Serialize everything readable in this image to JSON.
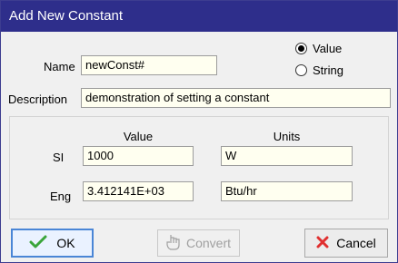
{
  "window": {
    "title": "Add New Constant"
  },
  "form": {
    "name_label": "Name",
    "name_value": "newConst#",
    "description_label": "Description",
    "description_value": "demonstration of setting a constant",
    "type_options": {
      "value_label": "Value",
      "string_label": "String",
      "selected": "Value"
    }
  },
  "table": {
    "value_header": "Value",
    "units_header": "Units",
    "si_label": "SI",
    "si_value": "1000",
    "si_units": "W",
    "eng_label": "Eng",
    "eng_value": "3.412141E+03",
    "eng_units": "Btu/hr"
  },
  "buttons": {
    "ok_label": "OK",
    "convert_label": "Convert",
    "cancel_label": "Cancel"
  },
  "colors": {
    "titlebar": "#2e2e8b",
    "field_bg": "#fffff0",
    "ok_check": "#3aa53a",
    "cancel_x": "#e03030"
  }
}
